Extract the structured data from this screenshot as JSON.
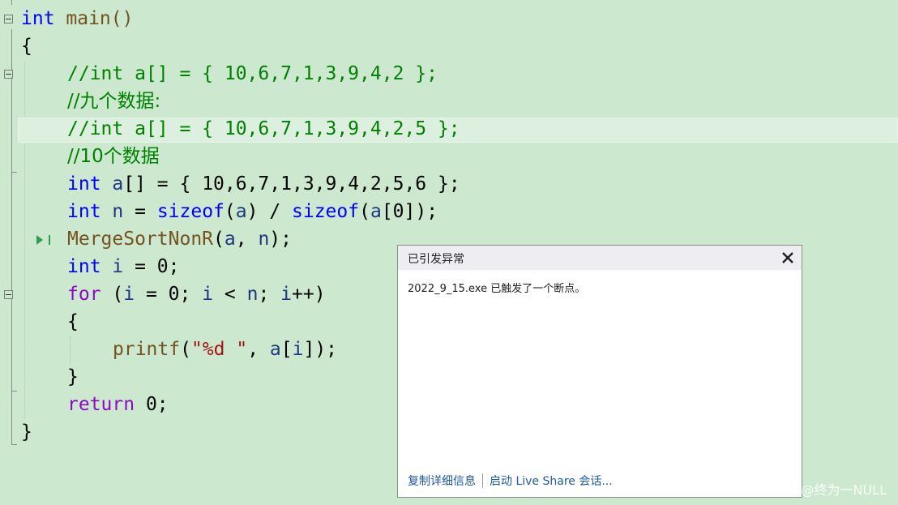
{
  "editor": {
    "lines": {
      "l1": {
        "kw": "int",
        "rest": " main()"
      },
      "l2": "{",
      "l3": "//int a[] = { 10,6,7,1,3,9,4,2 };",
      "l4": "//九个数据:",
      "l5": "//int a[] = { 10,6,7,1,3,9,4,2,5 };",
      "l6": "//10个数据",
      "l7": {
        "kw": "int",
        "var": "a",
        "rest": "[] = { 10,6,7,1,3,9,4,2,5,6 };"
      },
      "l8": {
        "kw": "int",
        "var": "n",
        "op": " = ",
        "fn1": "sizeof",
        "p1": "(",
        "a1": "a",
        "p2": ") / ",
        "fn2": "sizeof",
        "p3": "(",
        "a2": "a",
        "p4": "[0]);"
      },
      "l9": {
        "fn": "MergeSortNonR",
        "p1": "(",
        "a": "a",
        "sep": ", ",
        "n": "n",
        "p2": ");"
      },
      "l10": {
        "kw": "int",
        "var": "i",
        "rest": " = 0;"
      },
      "l11": {
        "kw": "for",
        "p1": " (",
        "i1": "i",
        "t1": " = 0; ",
        "i2": "i",
        "t2": " < ",
        "n": "n",
        "t3": "; ",
        "i3": "i",
        "t4": "++)"
      },
      "l12": "{",
      "l13": {
        "fn": "printf",
        "p1": "(",
        "str": "\"%d \"",
        "sep": ", ",
        "a": "a",
        "p2": "[",
        "i": "i",
        "p3": "]);"
      },
      "l14": "}",
      "l15": {
        "kw": "return",
        "rest": " 0;"
      },
      "l16": "}"
    },
    "exec_arrow_icon": "current-statement-arrow"
  },
  "popup": {
    "title": "已引发异常",
    "message": "2022_9_15.exe 已触发了一个断点。",
    "link_details": "复制详细信息",
    "link_liveshare": "启动 Live Share 会话..."
  },
  "watermark": "CSDN @终为一NULL",
  "colors": {
    "background": "#cce8cf",
    "keyword": "#0000ff",
    "control_keyword": "#8f08c4",
    "function": "#74531f",
    "variable": "#1f377f",
    "comment": "#008000",
    "string": "#a31515",
    "link": "#1f5aa6"
  }
}
